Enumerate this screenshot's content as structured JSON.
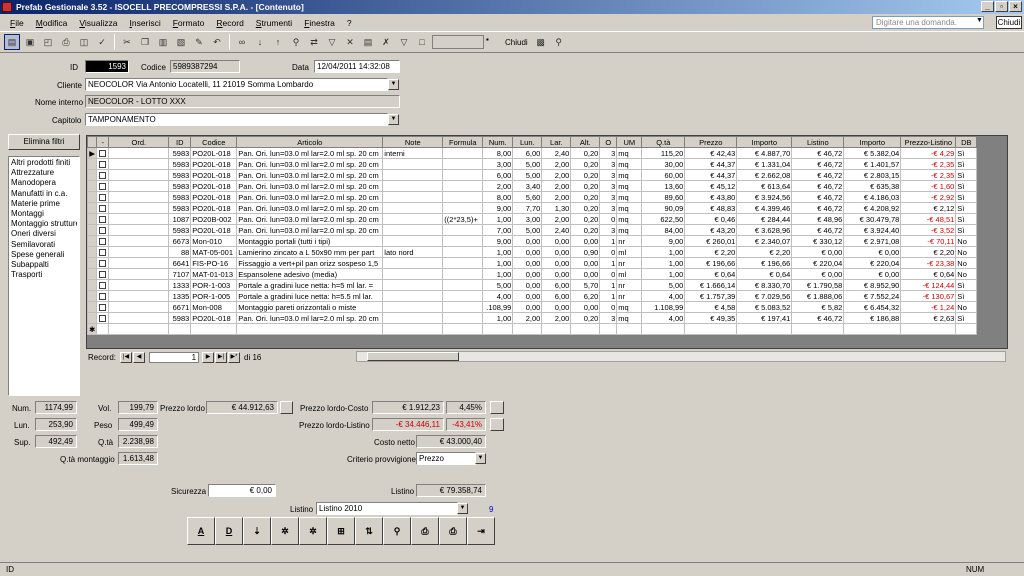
{
  "window": {
    "title": "Prefab Gestionale 3.52 - ISOCELL PRECOMPRESSI S.P.A. - [Contenuto]"
  },
  "menu": {
    "items": [
      "File",
      "Modifica",
      "Visualizza",
      "Inserisci",
      "Formato",
      "Record",
      "Strumenti",
      "Finestra",
      "?"
    ],
    "ask_placeholder": "Digitare una domanda.",
    "close_label": "Chiudi"
  },
  "toolbar": {
    "chiudi": "Chiudi"
  },
  "header": {
    "id_label": "ID",
    "id_value": "1593",
    "codice_label": "Codice",
    "codice_value": "5989387294",
    "data_label": "Data",
    "data_value": "12/04/2011 14:32:08",
    "cliente_label": "Cliente",
    "cliente_value": "NEOCOLOR    Via Antonio Locatelli, 11    21019  Somma Lombardo",
    "nome_label": "Nome interno",
    "nome_value": "NEOCOLOR - LOTTO XXX",
    "capitolo_label": "Capitolo",
    "capitolo_value": "TAMPONAMENTO"
  },
  "filters": {
    "button": "Elimina filtri",
    "categories": [
      "Altri prodotti finiti",
      "Attrezzature",
      "Manodopera",
      "Manufatti in c.a.",
      "Materie prime",
      "Montaggi",
      "Montaggio strutture",
      "Oneri diversi",
      "Semilavorati",
      "Spese generali",
      "Subappalti",
      "Trasporti"
    ]
  },
  "grid": {
    "columns": [
      "",
      "-",
      "Ord.",
      "ID",
      "Codice",
      "Articolo",
      "Note",
      "Formula",
      "Num.",
      "Lun.",
      "Lar.",
      "Alt.",
      "O",
      "UM",
      "Q.tà",
      "Prezzo",
      "Importo",
      "Listino",
      "Importo",
      "Prezzo-Listino",
      "DB"
    ],
    "rows": [
      [
        "",
        "",
        "5983",
        "PO20L-018",
        "Pan. Ori. lun=03.0 ml lar=2.0 ml sp. 20 cm",
        "interni",
        "",
        "8,00",
        "6,00",
        "2,40",
        "0,20",
        "3",
        "mq",
        "115,20",
        "€ 42,43",
        "€ 4.887,70",
        "€ 46,72",
        "€ 5.382,04",
        "-€ 4,29",
        "Sì"
      ],
      [
        "",
        "",
        "5983",
        "PO20L-018",
        "Pan. Ori. lun=03.0 ml lar=2.0 ml sp. 20 cm",
        "",
        "",
        "3,00",
        "5,00",
        "2,00",
        "0,20",
        "3",
        "mq",
        "30,00",
        "€ 44,37",
        "€ 1.331,04",
        "€ 46,72",
        "€ 1.401,57",
        "-€ 2,35",
        "Sì"
      ],
      [
        "",
        "",
        "5983",
        "PO20L-018",
        "Pan. Ori. lun=03.0 ml lar=2.0 ml sp. 20 cm",
        "",
        "",
        "6,00",
        "5,00",
        "2,00",
        "0,20",
        "3",
        "mq",
        "60,00",
        "€ 44,37",
        "€ 2.662,08",
        "€ 46,72",
        "€ 2.803,15",
        "-€ 2,35",
        "Sì"
      ],
      [
        "",
        "",
        "5983",
        "PO20L-018",
        "Pan. Ori. lun=03.0 ml lar=2.0 ml sp. 20 cm",
        "",
        "",
        "2,00",
        "3,40",
        "2,00",
        "0,20",
        "3",
        "mq",
        "13,60",
        "€ 45,12",
        "€ 613,64",
        "€ 46,72",
        "€ 635,38",
        "-€ 1,60",
        "Sì"
      ],
      [
        "",
        "",
        "5983",
        "PO20L-018",
        "Pan. Ori. lun=03.0 ml lar=2.0 ml sp. 20 cm",
        "",
        "",
        "8,00",
        "5,60",
        "2,00",
        "0,20",
        "3",
        "mq",
        "89,60",
        "€ 43,80",
        "€ 3.924,56",
        "€ 46,72",
        "€ 4.186,03",
        "-€ 2,92",
        "Sì"
      ],
      [
        "",
        "",
        "5983",
        "PO20L-018",
        "Pan. Ori. lun=03.0 ml lar=2.0 ml sp. 20 cm",
        "",
        "",
        "9,00",
        "7,70",
        "1,30",
        "0,20",
        "3",
        "mq",
        "90,09",
        "€ 48,83",
        "€ 4.399,46",
        "€ 46,72",
        "€ 4.208,92",
        "€ 2,12",
        "Sì"
      ],
      [
        "",
        "",
        "1087",
        "PO20B-002",
        "Pan. Ori. lun=03.0 ml lar=2.0 ml sp. 20 cm",
        "",
        "((2*23,5)+",
        "1,00",
        "3,00",
        "2,00",
        "0,20",
        "0",
        "mq",
        "622,50",
        "€ 0,46",
        "€ 284,44",
        "€ 48,96",
        "€ 30.479,78",
        "-€ 48,51",
        "Sì"
      ],
      [
        "",
        "",
        "5983",
        "PO20L-018",
        "Pan. Ori. lun=03.0 ml lar=2.0 ml sp. 20 cm",
        "",
        "",
        "7,00",
        "5,00",
        "2,40",
        "0,20",
        "3",
        "mq",
        "84,00",
        "€ 43,20",
        "€ 3.628,96",
        "€ 46,72",
        "€ 3.924,40",
        "-€ 3,52",
        "Sì"
      ],
      [
        "",
        "",
        "6673",
        "Mon-010",
        "Montaggio portali (tutti i tipi)",
        "",
        "",
        "9,00",
        "0,00",
        "0,00",
        "0,00",
        "1",
        "nr",
        "9,00",
        "€ 260,01",
        "€ 2.340,07",
        "€ 330,12",
        "€ 2.971,08",
        "-€ 70,11",
        "No"
      ],
      [
        "",
        "",
        "88",
        "MAT-05-001",
        "Lamierino zincato a L 50x90 mm per part",
        "lato nord",
        "",
        "1,00",
        "0,00",
        "0,00",
        "0,90",
        "0",
        "ml",
        "1,00",
        "€ 2,20",
        "€ 2,20",
        "€ 0,00",
        "€ 0,00",
        "€ 2,20",
        "No"
      ],
      [
        "",
        "",
        "6641",
        "FIS-PO-16",
        "Fissaggio a vert+pil pan orizz sospeso 1,5",
        "",
        "",
        "1,00",
        "0,00",
        "0,00",
        "0,00",
        "1",
        "nr",
        "1,00",
        "€ 196,66",
        "€ 196,66",
        "€ 220,04",
        "€ 220,04",
        "-€ 23,38",
        "No"
      ],
      [
        "",
        "",
        "7107",
        "MAT-01-013",
        "Espansolene adesivo (media)",
        "",
        "",
        "1,00",
        "0,00",
        "0,00",
        "0,00",
        "0",
        "ml",
        "1,00",
        "€ 0,64",
        "€ 0,64",
        "€ 0,00",
        "€ 0,00",
        "€ 0,64",
        "No"
      ],
      [
        "",
        "",
        "1333",
        "POR-1-003",
        "Portale a gradini luce netta: h=5 ml lar. =",
        "",
        "",
        "5,00",
        "0,00",
        "6,00",
        "5,70",
        "1",
        "nr",
        "5,00",
        "€ 1.666,14",
        "€ 8.330,70",
        "€ 1.790,58",
        "€ 8.952,90",
        "-€ 124,44",
        "Sì"
      ],
      [
        "",
        "",
        "1335",
        "POR-1-005",
        "Portale a gradini luce netta: h=5.5 ml lar.",
        "",
        "",
        "4,00",
        "0,00",
        "6,00",
        "6,20",
        "1",
        "nr",
        "4,00",
        "€ 1.757,39",
        "€ 7.029,56",
        "€ 1.888,06",
        "€ 7.552,24",
        "-€ 130,67",
        "Sì"
      ],
      [
        "",
        "",
        "6671",
        "Mon-008",
        "Montaggio pareti orizzontali o miste",
        "",
        "",
        ".108,99",
        "0,00",
        "0,00",
        "0,00",
        "0",
        "mq",
        "1.108,99",
        "€ 4,58",
        "€ 5.083,52",
        "€ 5,82",
        "€ 6.454,32",
        "-€ 1,24",
        "No"
      ],
      [
        "",
        "",
        "5983",
        "PO20L-018",
        "Pan. Ori. lun=03.0 ml lar=2.0 ml sp. 20 cm",
        "",
        "",
        "1,00",
        "2,00",
        "2,00",
        "0,20",
        "3",
        "mq",
        "4,00",
        "€ 49,35",
        "€ 197,41",
        "€ 46,72",
        "€ 186,88",
        "€ 2,63",
        "Sì"
      ]
    ]
  },
  "nav": {
    "label": "Record:",
    "current": "1",
    "total_text": "di 16"
  },
  "totals": {
    "num_label": "Num.",
    "num": "1174,99",
    "lun_label": "Lun.",
    "lun": "253,90",
    "sup_label": "Sup.",
    "sup": "492,49",
    "qtamont_label": "Q.tà montaggio",
    "qtamont": "1.613,48",
    "vol_label": "Vol.",
    "vol": "199,79",
    "peso_label": "Peso",
    "peso": "499,49",
    "qta_label": "Q.tà",
    "qta": "2.238,98",
    "prezzolordo_label": "Prezzo lordo",
    "prezzolordo": "€ 44.912,63",
    "plc_label": "Prezzo lordo-Costo",
    "plc": "€ 1.912,23",
    "plc_pct": "4,45%",
    "pll_label": "Prezzo lordo-Listino",
    "pll": "-€ 34.446,11",
    "pll_pct": "-43,41%",
    "costo_label": "Costo netto",
    "costo": "€ 43.000,40",
    "criterio_label": "Criterio provvigione",
    "criterio": "Prezzo",
    "sicurezza_label": "Sicurezza",
    "sicurezza": "€ 0,00",
    "listino_label": "Listino",
    "listino": "€ 79.358,74",
    "listino_sel_label": "Listino",
    "listino_sel": "Listino 2010",
    "listino_num": "9"
  },
  "actions": {
    "icons": [
      "A",
      "D",
      "sort-icon",
      "tool-icon",
      "tool2-icon",
      "grid-icon",
      "chart-icon",
      "search-icon",
      "print-icon",
      "print2-icon",
      "exit-icon"
    ]
  },
  "status": {
    "left": "ID",
    "right": "NUM"
  }
}
